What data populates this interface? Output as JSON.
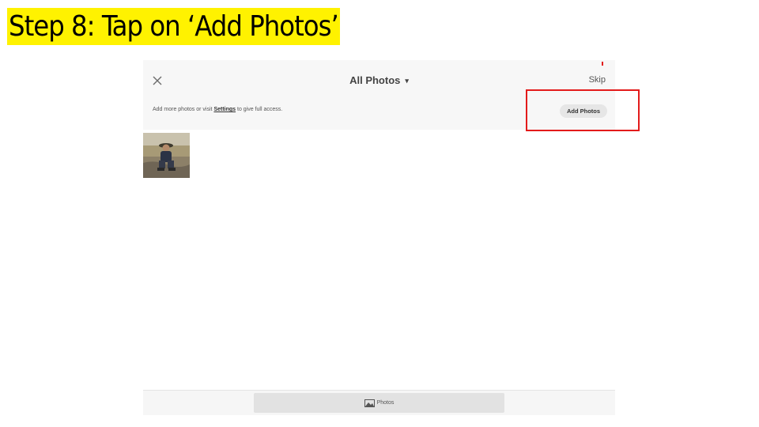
{
  "slide": {
    "title": "Step 8: Tap on ‘Add Photos’",
    "title_highlight_color": "#fff200",
    "callout_color": "#e31b1b"
  },
  "header": {
    "close_icon": "close-icon",
    "title": "All Photos",
    "title_caret": "▾",
    "skip_label": "Skip"
  },
  "access_notice": {
    "text_before": "Add more photos or visit ",
    "link_label": "Settings",
    "text_after": " to give full access.",
    "add_photos_label": "Add Photos"
  },
  "grid": {
    "photos": [
      "photo-thumbnail"
    ]
  },
  "bottom_bar": {
    "tab_icon": "photo-icon",
    "tab_label": "Photos"
  }
}
